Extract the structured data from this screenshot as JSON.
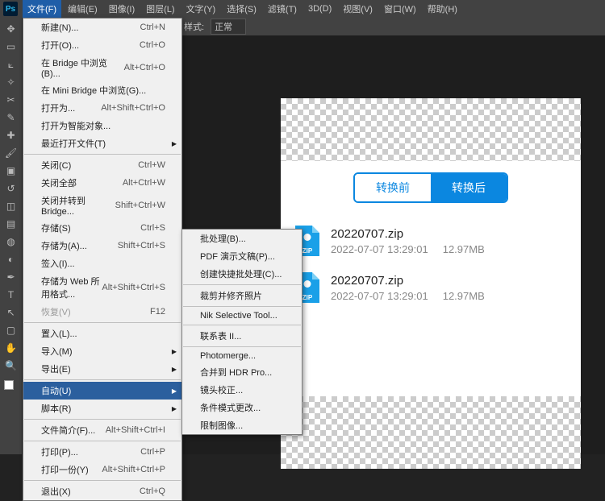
{
  "app": {
    "logo": "Ps"
  },
  "menubar": [
    "文件(F)",
    "编辑(E)",
    "图像(I)",
    "图层(L)",
    "文字(Y)",
    "选择(S)",
    "滤镜(T)",
    "3D(D)",
    "视图(V)",
    "窗口(W)",
    "帮助(H)"
  ],
  "optionsbar": {
    "label": "样式:",
    "value": "正常"
  },
  "fileMenu": {
    "groups": [
      [
        {
          "label": "新建(N)...",
          "shortcut": "Ctrl+N"
        },
        {
          "label": "打开(O)...",
          "shortcut": "Ctrl+O"
        },
        {
          "label": "在 Bridge 中浏览(B)...",
          "shortcut": "Alt+Ctrl+O"
        },
        {
          "label": "在 Mini Bridge 中浏览(G)..."
        },
        {
          "label": "打开为...",
          "shortcut": "Alt+Shift+Ctrl+O"
        },
        {
          "label": "打开为智能对象..."
        },
        {
          "label": "最近打开文件(T)",
          "arrow": true
        }
      ],
      [
        {
          "label": "关闭(C)",
          "shortcut": "Ctrl+W"
        },
        {
          "label": "关闭全部",
          "shortcut": "Alt+Ctrl+W"
        },
        {
          "label": "关闭并转到 Bridge...",
          "shortcut": "Shift+Ctrl+W"
        },
        {
          "label": "存储(S)",
          "shortcut": "Ctrl+S"
        },
        {
          "label": "存储为(A)...",
          "shortcut": "Shift+Ctrl+S"
        },
        {
          "label": "签入(I)..."
        },
        {
          "label": "存储为 Web 所用格式...",
          "shortcut": "Alt+Shift+Ctrl+S"
        },
        {
          "label": "恢复(V)",
          "shortcut": "F12",
          "disabled": true
        }
      ],
      [
        {
          "label": "置入(L)..."
        },
        {
          "label": "导入(M)",
          "arrow": true
        },
        {
          "label": "导出(E)",
          "arrow": true
        }
      ],
      [
        {
          "label": "自动(U)",
          "arrow": true,
          "highlighted": true
        },
        {
          "label": "脚本(R)",
          "arrow": true
        }
      ],
      [
        {
          "label": "文件简介(F)...",
          "shortcut": "Alt+Shift+Ctrl+I"
        }
      ],
      [
        {
          "label": "打印(P)...",
          "shortcut": "Ctrl+P"
        },
        {
          "label": "打印一份(Y)",
          "shortcut": "Alt+Shift+Ctrl+P"
        }
      ],
      [
        {
          "label": "退出(X)",
          "shortcut": "Ctrl+Q"
        }
      ]
    ]
  },
  "automateSubmenu": [
    [
      {
        "label": "批处理(B)..."
      },
      {
        "label": "PDF 演示文稿(P)..."
      },
      {
        "label": "创建快捷批处理(C)..."
      }
    ],
    [
      {
        "label": "裁剪并修齐照片"
      }
    ],
    [
      {
        "label": "Nik Selective Tool..."
      }
    ],
    [
      {
        "label": "联系表 II..."
      }
    ],
    [
      {
        "label": "Photomerge..."
      },
      {
        "label": "合并到 HDR Pro..."
      },
      {
        "label": "镜头校正..."
      },
      {
        "label": "条件模式更改..."
      },
      {
        "label": "限制图像..."
      }
    ]
  ],
  "canvas": {
    "tabs": {
      "before": "转换前",
      "after": "转换后"
    },
    "files": [
      {
        "name": "20220707.zip",
        "date": "2022-07-07 13:29:01",
        "size": "12.97MB",
        "ext": "ZIP"
      },
      {
        "name": "20220707.zip",
        "date": "2022-07-07 13:29:01",
        "size": "12.97MB",
        "ext": "ZIP"
      }
    ]
  }
}
